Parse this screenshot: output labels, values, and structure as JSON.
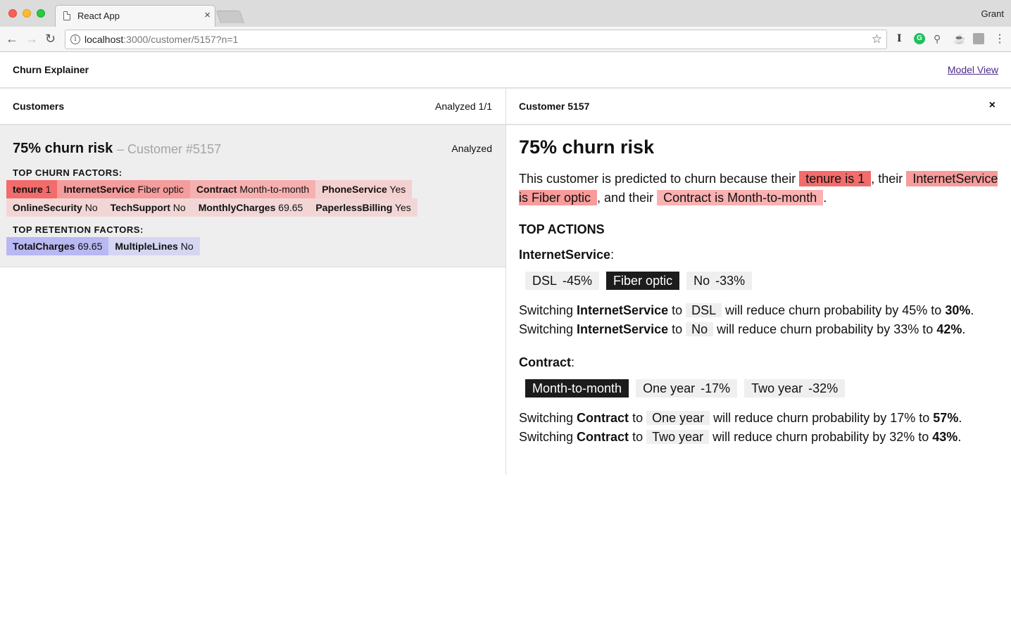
{
  "browser": {
    "tab_title": "React App",
    "profile": "Grant",
    "url_host": "localhost",
    "url_rest": ":3000/customer/5157?n=1"
  },
  "app": {
    "title": "Churn Explainer",
    "model_link": "Model View"
  },
  "customers_pane": {
    "title": "Customers",
    "count": "Analyzed 1/1",
    "card": {
      "risk": "75% churn risk",
      "id": "– Customer #5157",
      "status": "Analyzed",
      "churn_label": "TOP CHURN FACTORS:",
      "churn_factors": [
        {
          "name": "tenure",
          "value": "1",
          "color": "#f36b6b"
        },
        {
          "name": "InternetService",
          "value": "Fiber optic",
          "color": "#f59c9c"
        },
        {
          "name": "Contract",
          "value": "Month-to-month",
          "color": "#f6b0b0"
        },
        {
          "name": "PhoneService",
          "value": "Yes",
          "color": "#f4d0d0"
        },
        {
          "name": "OnlineSecurity",
          "value": "No",
          "color": "#f2d6d6"
        },
        {
          "name": "TechSupport",
          "value": "No",
          "color": "#f2d6d6"
        },
        {
          "name": "MonthlyCharges",
          "value": "69.65",
          "color": "#f2d6d6"
        },
        {
          "name": "PaperlessBilling",
          "value": "Yes",
          "color": "#f2d6d6"
        }
      ],
      "retention_label": "TOP RETENTION FACTORS:",
      "retention_factors": [
        {
          "name": "TotalCharges",
          "value": "69.65",
          "color": "#b9b8f3"
        },
        {
          "name": "MultipleLines",
          "value": "No",
          "color": "#d6d6f2"
        }
      ]
    }
  },
  "detail_pane": {
    "title": "Customer 5157",
    "close": "×",
    "risk": "75% churn risk",
    "explain": {
      "prefix": "This customer is predicted to churn because their",
      "factor1": "tenure is 1",
      "sep1": ", their",
      "factor2": "InternetService is Fiber optic",
      "sep2": ", and their",
      "factor3": "Contract is Month-to-month",
      "suffix": "."
    },
    "top_actions": "TOP ACTIONS",
    "features": [
      {
        "name": "InternetService",
        "options": [
          {
            "label": "DSL",
            "pct": "-45%",
            "selected": false
          },
          {
            "label": "Fiber optic",
            "pct": "",
            "selected": true
          },
          {
            "label": "No",
            "pct": "-33%",
            "selected": false
          }
        ],
        "sentences": [
          {
            "target": "DSL",
            "reduction": "45%",
            "result": "30%"
          },
          {
            "target": "No",
            "reduction": "33%",
            "result": "42%"
          }
        ]
      },
      {
        "name": "Contract",
        "options": [
          {
            "label": "Month-to-month",
            "pct": "",
            "selected": true
          },
          {
            "label": "One year",
            "pct": "-17%",
            "selected": false
          },
          {
            "label": "Two year",
            "pct": "-32%",
            "selected": false
          }
        ],
        "sentences": [
          {
            "target": "One year",
            "reduction": "17%",
            "result": "57%"
          },
          {
            "target": "Two year",
            "reduction": "32%",
            "result": "43%"
          }
        ]
      }
    ]
  }
}
